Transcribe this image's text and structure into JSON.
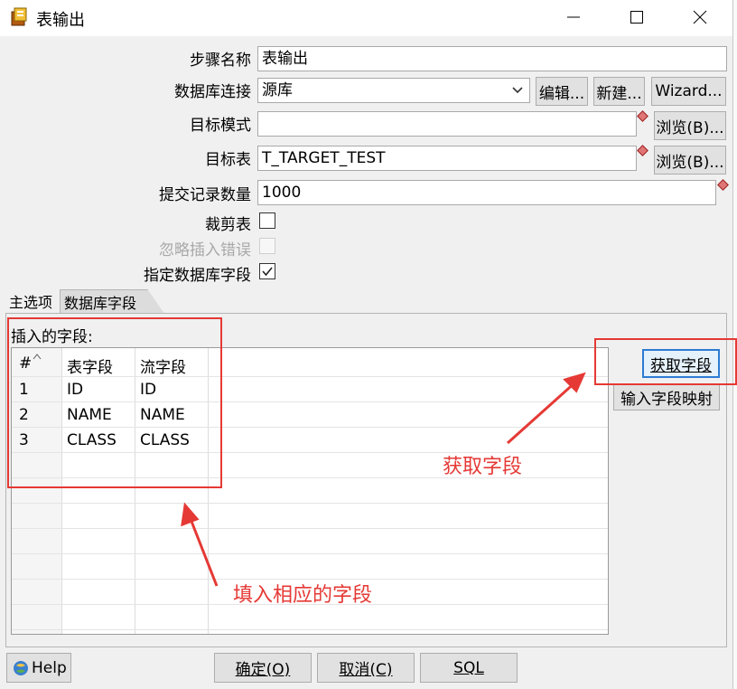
{
  "window": {
    "title": "表输出",
    "icons": [
      "app-icon",
      "minimize-icon",
      "maximize-icon",
      "close-icon"
    ]
  },
  "form": {
    "step_name_label": "步骤名称",
    "step_name_value": "表输出",
    "connection_label": "数据库连接",
    "connection_value": "源库",
    "edit_button": "编辑...",
    "new_button": "新建...",
    "wizard_button": "Wizard...",
    "target_schema_label": "目标模式",
    "target_schema_value": "",
    "browse_button_1": "浏览(B)...",
    "target_table_label": "目标表",
    "target_table_value": "T_TARGET_TEST",
    "browse_button_2": "浏览(B)...",
    "commit_size_label": "提交记录数量",
    "commit_size_value": "1000",
    "truncate_label": "裁剪表",
    "truncate_checked": false,
    "ignore_errors_label": "忽略插入错误",
    "ignore_errors_checked": false,
    "specify_fields_label": "指定数据库字段",
    "specify_fields_checked": true
  },
  "tabs": [
    {
      "label": "主选项",
      "active": false
    },
    {
      "label": "数据库字段",
      "active": true
    }
  ],
  "db_fields": {
    "section_label": "插入的字段:",
    "columns": [
      "#",
      "表字段",
      "流字段"
    ],
    "rows": [
      {
        "num": "1",
        "table_field": "ID",
        "stream_field": "ID"
      },
      {
        "num": "2",
        "table_field": "NAME",
        "stream_field": "NAME"
      },
      {
        "num": "3",
        "table_field": "CLASS",
        "stream_field": "CLASS"
      }
    ],
    "get_fields_button": "获取字段",
    "map_fields_button": "输入字段映射"
  },
  "annotations": {
    "get_fields_note": "获取字段",
    "fill_fields_note": "填入相应的字段",
    "color": "#e53935"
  },
  "footer": {
    "help_button": "Help",
    "ok_button": "确定(O)",
    "cancel_button": "取消(C)",
    "sql_button": "SQL"
  }
}
